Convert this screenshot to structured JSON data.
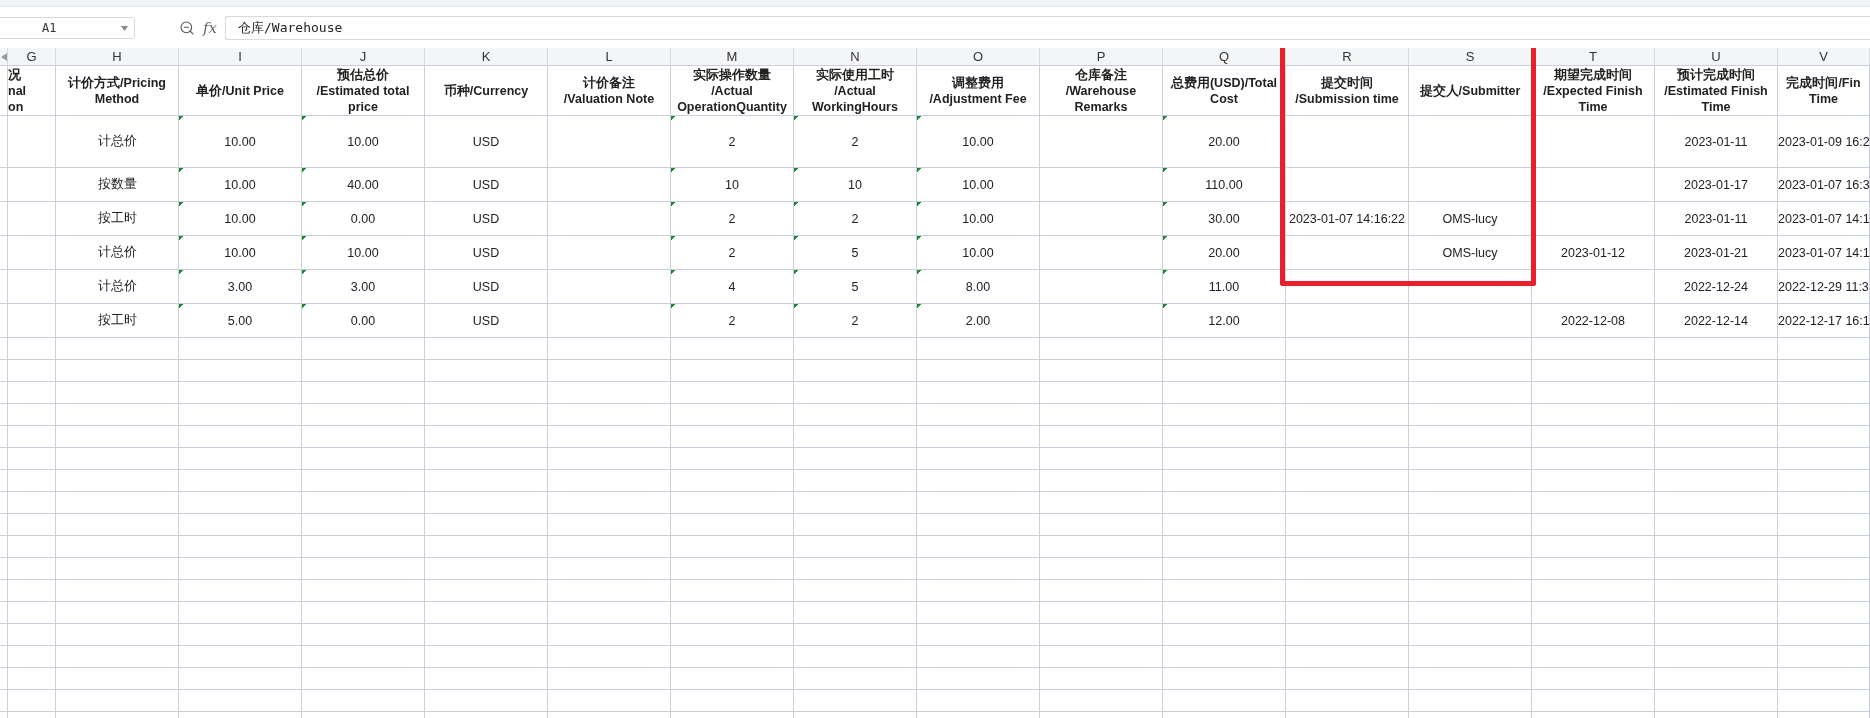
{
  "formula_bar": {
    "name_box": "A1",
    "fx_label": "fx",
    "formula": "仓库/Warehouse"
  },
  "columns": [
    {
      "letter": "G",
      "header": "况\nnal\non",
      "highlighted": false
    },
    {
      "letter": "H",
      "header": "计价方式/Pricing\nMethod",
      "highlighted": false,
      "number_flag": false
    },
    {
      "letter": "I",
      "header": "单价/Unit Price",
      "highlighted": false,
      "number_flag": true
    },
    {
      "letter": "J",
      "header": "预估总价\n/Estimated total\nprice",
      "highlighted": false,
      "number_flag": true
    },
    {
      "letter": "K",
      "header": "币种/Currency",
      "highlighted": false,
      "number_flag": false
    },
    {
      "letter": "L",
      "header": "计价备注\n/Valuation Note",
      "highlighted": false
    },
    {
      "letter": "M",
      "header": "实际操作数量\n/Actual\nOperationQuantity",
      "highlighted": false,
      "number_flag": true
    },
    {
      "letter": "N",
      "header": "实际使用工时\n/Actual\nWorkingHours",
      "highlighted": false,
      "number_flag": true
    },
    {
      "letter": "O",
      "header": "调整费用\n/Adjustment Fee",
      "highlighted": false,
      "number_flag": true
    },
    {
      "letter": "P",
      "header": "仓库备注\n/Warehouse\nRemarks",
      "highlighted": false
    },
    {
      "letter": "Q",
      "header": "总费用(USD)/Total\nCost",
      "highlighted": false,
      "number_flag": true
    },
    {
      "letter": "R",
      "header": "提交时间\n/Submission time",
      "highlighted": true,
      "number_flag": false
    },
    {
      "letter": "S",
      "header": "提交人/Submitter",
      "highlighted": true,
      "number_flag": false
    },
    {
      "letter": "T",
      "header": "期望完成时间\n/Expected Finish\nTime",
      "highlighted": false,
      "number_flag": false
    },
    {
      "letter": "U",
      "header": "预计完成时间\n/Estimated Finish\nTime",
      "highlighted": false,
      "number_flag": false
    },
    {
      "letter": "V",
      "header": "完成时间/Fin\nTime",
      "highlighted": false,
      "number_flag": false
    }
  ],
  "rows": [
    {
      "H": "计总价",
      "I": "10.00",
      "J": "10.00",
      "K": "USD",
      "M": "2",
      "N": "2",
      "O": "10.00",
      "Q": "20.00",
      "U": "2023-01-11",
      "V": "2023-01-09 16:2"
    },
    {
      "H": "按数量",
      "I": "10.00",
      "J": "40.00",
      "K": "USD",
      "M": "10",
      "N": "10",
      "O": "10.00",
      "Q": "110.00",
      "U": "2023-01-17",
      "V": "2023-01-07 16:3"
    },
    {
      "H": "按工时",
      "I": "10.00",
      "J": "0.00",
      "K": "USD",
      "M": "2",
      "N": "2",
      "O": "10.00",
      "Q": "30.00",
      "R": "2023-01-07 14:16:22",
      "S": "OMS-lucy",
      "U": "2023-01-11",
      "V": "2023-01-07 14:1"
    },
    {
      "H": "计总价",
      "I": "10.00",
      "J": "10.00",
      "K": "USD",
      "M": "2",
      "N": "5",
      "O": "10.00",
      "Q": "20.00",
      "S": "OMS-lucy",
      "T": "2023-01-12",
      "U": "2023-01-21",
      "V": "2023-01-07 14:1"
    },
    {
      "H": "计总价",
      "I": "3.00",
      "J": "3.00",
      "K": "USD",
      "M": "4",
      "N": "5",
      "O": "8.00",
      "Q": "11.00",
      "U": "2022-12-24",
      "V": "2022-12-29 11:3"
    },
    {
      "H": "按工时",
      "I": "5.00",
      "J": "0.00",
      "K": "USD",
      "M": "2",
      "N": "2",
      "O": "2.00",
      "Q": "12.00",
      "T": "2022-12-08",
      "U": "2022-12-14",
      "V": "2022-12-17 16:1"
    }
  ]
}
